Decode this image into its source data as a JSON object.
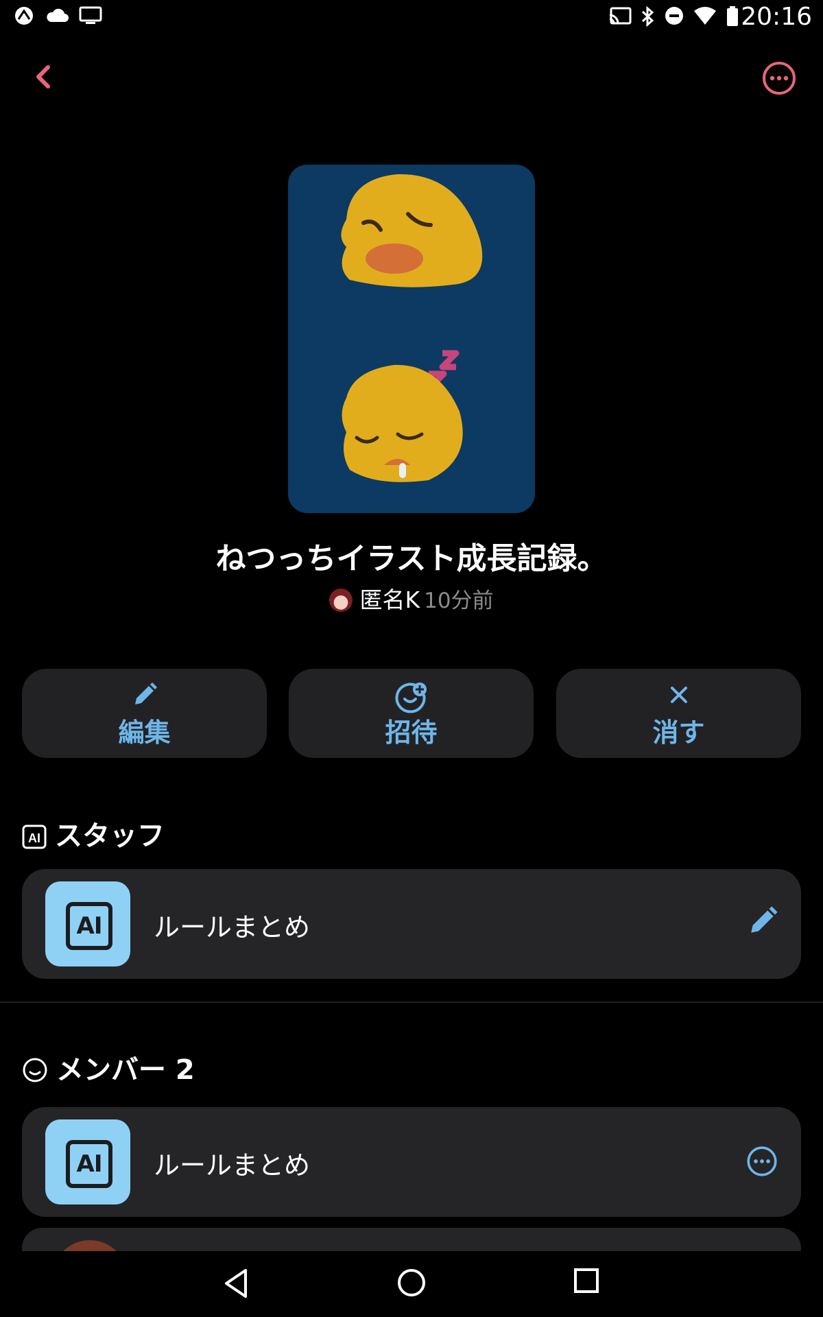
{
  "status_bar": {
    "time": "20:16"
  },
  "room": {
    "title": "ねつっちイラスト成長記録。",
    "author": "匿名K",
    "time_ago": "10分前"
  },
  "actions": [
    {
      "label": "編集",
      "icon": "pencil-icon"
    },
    {
      "label": "招待",
      "icon": "invite-face-plus-icon"
    },
    {
      "label": "消す",
      "icon": "close-icon"
    }
  ],
  "staff_section": {
    "title": "スタッフ",
    "items": [
      {
        "label": "ルールまとめ",
        "tile_text": "AI",
        "trail_icon": "pencil-icon"
      }
    ]
  },
  "member_section": {
    "title": "メンバー 2",
    "items": [
      {
        "label": "ルールまとめ",
        "tile_text": "AI",
        "trail_icon": "more-icon"
      }
    ]
  },
  "section_icon_text": "AI",
  "colors": {
    "accent_pink": "#e8657a",
    "accent_blue": "#6eb6ea",
    "card_bg": "#252527",
    "ai_tile": "#8fd1f5"
  }
}
